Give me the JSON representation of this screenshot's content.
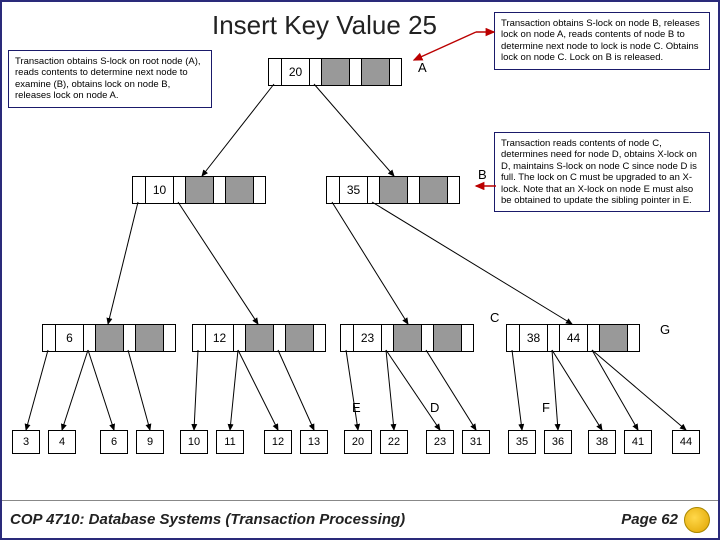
{
  "title": "Insert Key Value 25",
  "notes": {
    "n1": "Transaction obtains S-lock on root node (A), reads contents to determine next node to examine (B), obtains lock on node B, releases lock on node A.",
    "n2": "Transaction obtains S-lock on node B, releases lock on node A, reads contents of node B to determine next node to lock is node C. Obtains lock on node C. Lock on B is released.",
    "n3": "Transaction reads contents of node C, determines need for node D, obtains X-lock on D, maintains S-lock on node C since node D is full. The lock on C must be upgraded to an X-lock. Note that an X-lock on node E must also be obtained to update the sibling pointer in E."
  },
  "labels": {
    "A": "A",
    "B": "B",
    "C": "C",
    "D": "D",
    "E": "E",
    "F": "F",
    "G": "G"
  },
  "root": {
    "k1": "20"
  },
  "lvl1": {
    "n1": {
      "k1": "10"
    },
    "n2": {
      "k1": "35"
    }
  },
  "lvl2": {
    "n1": {
      "k1": "6"
    },
    "n2": {
      "k1": "12"
    },
    "n3": {
      "k1": "23"
    },
    "n4": {
      "k1": "38",
      "k2": "44"
    }
  },
  "leaves": [
    "3",
    "4",
    "6",
    "9",
    "10",
    "11",
    "12",
    "13",
    "20",
    "22",
    "23",
    "31",
    "35",
    "36",
    "38",
    "41",
    "44"
  ],
  "footer": {
    "course": "COP 4710: Database Systems  (Transaction Processing)",
    "page": "Page 62"
  }
}
